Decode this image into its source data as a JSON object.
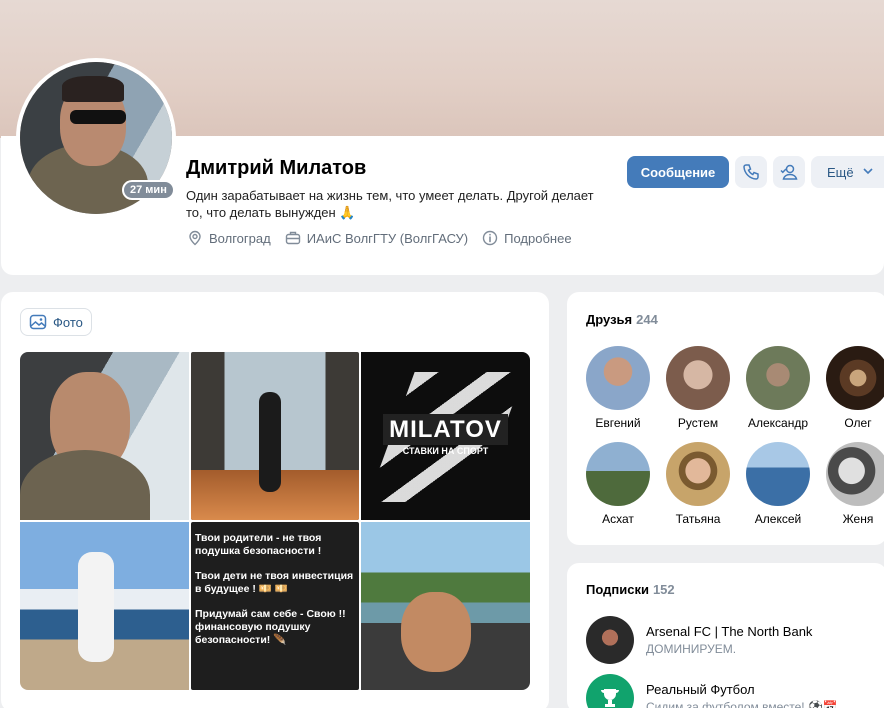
{
  "profile": {
    "name": "Дмитрий Милатов",
    "last_seen": "27 мин",
    "status": "Один зарабатывает на жизнь тем, что умеет делать. Другой делает то, что делать вынужден 🙏",
    "city": "Волгоград",
    "education": "ИАиС ВолгГТУ (ВолгГАСУ)",
    "details_link": "Подробнее"
  },
  "actions": {
    "message": "Сообщение",
    "more": "Ещё"
  },
  "photos": {
    "button_label": "Фото",
    "tile3_logo": "MILATOV",
    "tile3_sub": "СТАВКИ НА СПОРТ",
    "tile5_lines": [
      "Твои родители - не твоя подушка безопасности !",
      "Твои дети не твоя инвестиция в будущее ! 💴 💴",
      "Придумай сам себе - Свою !! финансовую подушку безопасности! 🪶"
    ]
  },
  "friends": {
    "title": "Друзья",
    "count": "244",
    "items": [
      {
        "name": "Евгений",
        "color": "#8aa6c9"
      },
      {
        "name": "Рустем",
        "color": "#c9a79a"
      },
      {
        "name": "Александр",
        "color": "#6d7a5a"
      },
      {
        "name": "Олег",
        "color": "#3a2a1e"
      },
      {
        "name": "Асхат",
        "color": "#4e6a3c"
      },
      {
        "name": "Татьяна",
        "color": "#b5874e"
      },
      {
        "name": "Алексей",
        "color": "#3b6fa6"
      },
      {
        "name": "Женя",
        "color": "#8c8c8c"
      }
    ]
  },
  "subscriptions": {
    "title": "Подписки",
    "count": "152",
    "items": [
      {
        "name": "Arsenal FC | The North Bank",
        "desc": "ДОМИНИРУЕМ."
      },
      {
        "name": "Реальный Футбол",
        "desc": "Сидим за футболом вместе! ⚽📅"
      }
    ]
  }
}
